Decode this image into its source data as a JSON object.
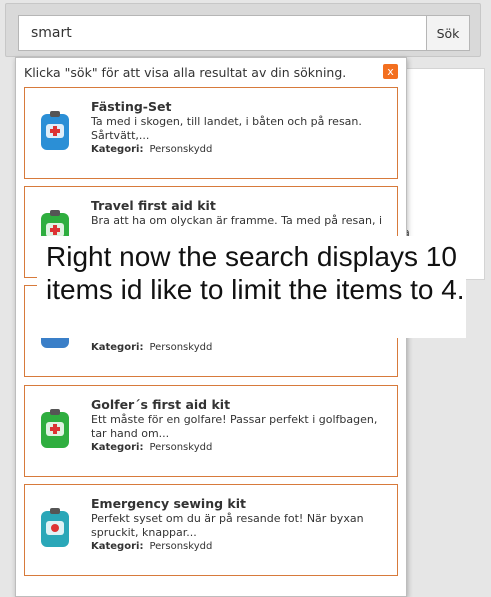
{
  "search": {
    "value": "smart",
    "button_label": "Sök"
  },
  "dropdown": {
    "hint": "Klicka \"sök\" för att visa alla resultat av din sökning.",
    "close_label": "x",
    "category_label": "Kategori:"
  },
  "results": [
    {
      "title": "Fästing-Set",
      "desc": "Ta med i skogen, till landet, i båten och på resan. Sårtvätt,...",
      "category": "Personskydd",
      "thumb_color": "#2b8fd6"
    },
    {
      "title": "Travel first aid kit",
      "desc": "Bra att ha om olyckan är framme. Ta med på resan, i",
      "category": "",
      "thumb_color": "#2fae3f"
    },
    {
      "title": "",
      "desc": "",
      "category": "Personskydd",
      "thumb_color": "#3a7fc8"
    },
    {
      "title": "Golfer´s first aid kit",
      "desc": "Ett måste för en golfare! Passar perfekt i golfbagen, tar hand om...",
      "category": "Personskydd",
      "thumb_color": "#2fae3f"
    },
    {
      "title": "Emergency sewing kit",
      "desc": "Perfekt syset om du är på resande fot! När byxan spruckit, knappar...",
      "category": "Personskydd",
      "thumb_color": "#2aa7b8"
    }
  ],
  "background_fragment": "a",
  "overlay": {
    "caption": "Right now the search displays 10 items id like to limit the items to 4."
  }
}
